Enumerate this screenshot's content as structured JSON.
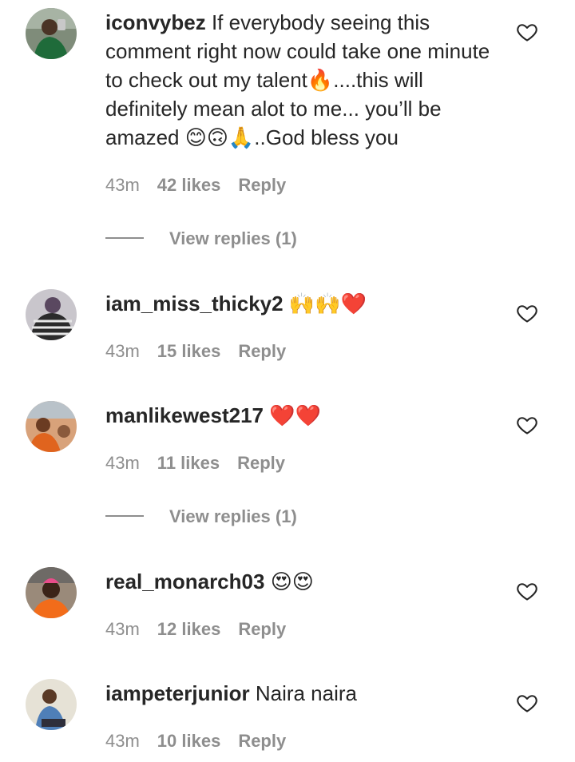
{
  "comments": [
    {
      "username": "iconvybez",
      "text": "If everybody seeing this comment right now could take one minute to check out my talent🔥....this will definitely mean alot to me... you’ll be amazed 😊🙃🙏..God bless you",
      "time": "43m",
      "likes": "42 likes",
      "reply": "Reply",
      "view_replies": "View replies (1)",
      "avatar_icon": "profile-photo",
      "like_icon": "heart-outline-icon"
    },
    {
      "username": "iam_miss_thicky2",
      "text": "🙌🙌❤️",
      "time": "43m",
      "likes": "15 likes",
      "reply": "Reply",
      "avatar_icon": "profile-photo",
      "like_icon": "heart-outline-icon"
    },
    {
      "username": "manlikewest217",
      "text": "❤️❤️",
      "time": "43m",
      "likes": "11 likes",
      "reply": "Reply",
      "view_replies": "View replies (1)",
      "avatar_icon": "profile-photo",
      "like_icon": "heart-outline-icon"
    },
    {
      "username": "real_monarch03",
      "text": "😍😍",
      "time": "43m",
      "likes": "12 likes",
      "reply": "Reply",
      "avatar_icon": "profile-photo",
      "like_icon": "heart-outline-icon"
    },
    {
      "username": "iampeterjunior",
      "text": "Naira naira",
      "time": "43m",
      "likes": "10 likes",
      "reply": "Reply",
      "avatar_icon": "profile-photo",
      "like_icon": "heart-outline-icon"
    }
  ],
  "colors": {
    "text": "#262626",
    "secondary": "#8e8e8e",
    "background": "#ffffff"
  }
}
